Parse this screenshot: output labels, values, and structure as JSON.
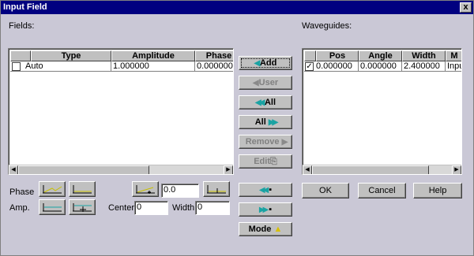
{
  "window": {
    "title": "Input Field",
    "close_glyph": "x"
  },
  "fields": {
    "label": "Fields:",
    "columns": [
      "Type",
      "Amplitude",
      "Phase"
    ],
    "rows": [
      {
        "checked": false,
        "type": "Auto",
        "amplitude": "1.000000",
        "phase": "0.000000"
      }
    ]
  },
  "waveguides": {
    "label": "Waveguides:",
    "columns": [
      "Pos",
      "Angle",
      "Width",
      "M"
    ],
    "rows": [
      {
        "checked": true,
        "pos": "0.000000",
        "angle": "0.000000",
        "width": "2.400000",
        "mode": "Input"
      }
    ]
  },
  "middle_buttons": {
    "add": "Add",
    "user": "User",
    "all_left": "All",
    "all_right": "All",
    "remove": "Remove",
    "edit": "Edit",
    "mode": "Mode"
  },
  "controls": {
    "phase_label": "Phase",
    "amp_label": "Amp.",
    "center_label": "Center",
    "width_label": "Width",
    "phase_value": "0.0",
    "center_value": "0",
    "width_value": "0"
  },
  "dialog_buttons": {
    "ok": "OK",
    "cancel": "Cancel",
    "help": "Help"
  },
  "colors": {
    "titlebar": "#000080",
    "dialog_bg": "#cac8d6",
    "arrow_teal": "#1aa3a3"
  }
}
